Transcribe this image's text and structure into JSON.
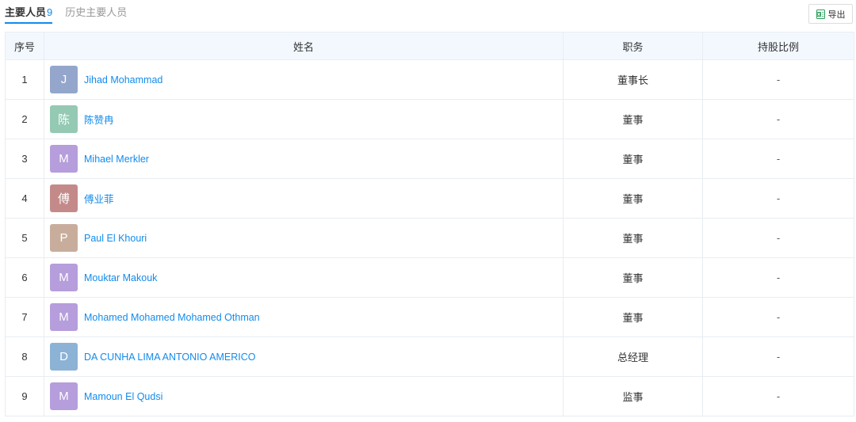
{
  "tabs": [
    {
      "label": "主要人员",
      "count": "9",
      "active": true
    },
    {
      "label": "历史主要人员",
      "active": false
    }
  ],
  "export": {
    "label": "导出",
    "icon": "excel-icon"
  },
  "table": {
    "headers": [
      "序号",
      "姓名",
      "职务",
      "持股比例"
    ],
    "rows": [
      {
        "index": "1",
        "avatar": "J",
        "avatar_color": "#94a6cc",
        "name": "Jihad Mohammad",
        "title": "董事长",
        "share": "-"
      },
      {
        "index": "2",
        "avatar": "陈",
        "avatar_color": "#94c9b3",
        "name": "陈赞冉",
        "title": "董事",
        "share": "-"
      },
      {
        "index": "3",
        "avatar": "M",
        "avatar_color": "#b69ddb",
        "name": "Mihael Merkler",
        "title": "董事",
        "share": "-"
      },
      {
        "index": "4",
        "avatar": "傅",
        "avatar_color": "#c48a8a",
        "name": "傅业菲",
        "title": "董事",
        "share": "-"
      },
      {
        "index": "5",
        "avatar": "P",
        "avatar_color": "#c9ad9c",
        "name": "Paul El Khouri",
        "title": "董事",
        "share": "-"
      },
      {
        "index": "6",
        "avatar": "M",
        "avatar_color": "#b69ddb",
        "name": "Mouktar Makouk",
        "title": "董事",
        "share": "-"
      },
      {
        "index": "7",
        "avatar": "M",
        "avatar_color": "#b69ddb",
        "name": "Mohamed Mohamed Mohamed Othman",
        "title": "董事",
        "share": "-"
      },
      {
        "index": "8",
        "avatar": "D",
        "avatar_color": "#8cb2d6",
        "name": "DA CUNHA LIMA ANTONIO AMERICO",
        "title": "总经理",
        "share": "-"
      },
      {
        "index": "9",
        "avatar": "M",
        "avatar_color": "#b69ddb",
        "name": "Mamoun El Qudsi",
        "title": "监事",
        "share": "-"
      }
    ]
  }
}
